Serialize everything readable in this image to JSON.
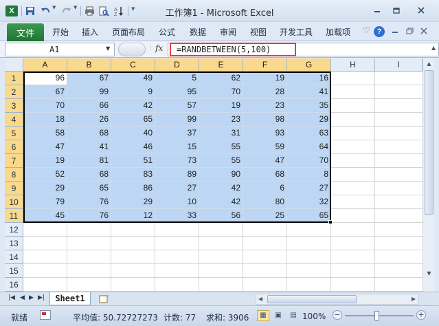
{
  "window": {
    "title": "工作簿1 - Microsoft Excel",
    "app_icon": "X"
  },
  "qat": {
    "icons": [
      "save-icon",
      "undo-icon",
      "redo-icon",
      "print-icon",
      "print-preview-icon",
      "sort-icon",
      "customize-icon"
    ]
  },
  "ribbon": {
    "file_label": "文件",
    "tabs": [
      "开始",
      "插入",
      "页面布局",
      "公式",
      "数据",
      "审阅",
      "视图",
      "开发工具",
      "加载项"
    ]
  },
  "formula_bar": {
    "name_box": "A1",
    "fx_label": "fx",
    "formula": "=RANDBETWEEN(5,100)"
  },
  "grid": {
    "columns": [
      "A",
      "B",
      "C",
      "D",
      "E",
      "F",
      "G",
      "H",
      "I"
    ],
    "selected_columns": [
      "A",
      "B",
      "C",
      "D",
      "E",
      "F",
      "G"
    ],
    "rows": [
      "1",
      "2",
      "3",
      "4",
      "5",
      "6",
      "7",
      "8",
      "9",
      "10",
      "11",
      "12",
      "13",
      "14",
      "15",
      "16"
    ],
    "data": [
      [
        96,
        67,
        49,
        5,
        62,
        19,
        16
      ],
      [
        67,
        99,
        9,
        95,
        70,
        28,
        41
      ],
      [
        70,
        66,
        42,
        57,
        19,
        23,
        35
      ],
      [
        18,
        26,
        65,
        99,
        23,
        98,
        29
      ],
      [
        58,
        68,
        40,
        37,
        31,
        93,
        63
      ],
      [
        47,
        41,
        46,
        15,
        55,
        59,
        64
      ],
      [
        19,
        81,
        51,
        73,
        55,
        47,
        70
      ],
      [
        52,
        68,
        83,
        89,
        90,
        68,
        8
      ],
      [
        29,
        65,
        86,
        27,
        42,
        6,
        27
      ],
      [
        79,
        76,
        29,
        10,
        42,
        80,
        32
      ],
      [
        45,
        76,
        12,
        33,
        56,
        25,
        65
      ]
    ]
  },
  "sheets": {
    "tabs": [
      "Sheet1"
    ]
  },
  "status": {
    "ready": "就绪",
    "average": "平均值: 50.72727273",
    "count": "计数: 77",
    "sum": "求和: 3906",
    "zoom": "100%"
  },
  "colors": {
    "selection_fill": "#bcd6f4",
    "header_highlight": "#f9d98d",
    "file_tab": "#1f7432",
    "formula_outline": "#e04040"
  }
}
